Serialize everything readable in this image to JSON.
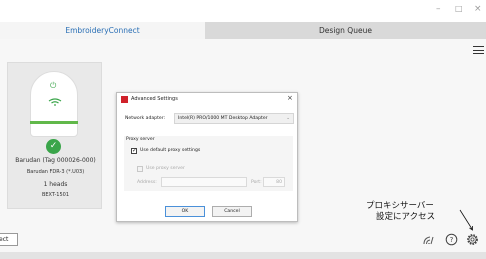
{
  "window": {
    "minimize_glyph": "–",
    "maximize_glyph": "□",
    "close_glyph": "×"
  },
  "tabs": [
    {
      "label": "EmbroideryConnect"
    },
    {
      "label": "Design Queue"
    }
  ],
  "device_card": {
    "name": "Barudan (Tag 000026-000)",
    "model": "Barudan FDR-3 (*.U03)",
    "heads": "1 heads",
    "code": "BEXT-1501",
    "status_color": "#3aa54a"
  },
  "dialog": {
    "title": "Advanced Settings",
    "network_adapter_label": "Network adapter:",
    "network_adapter_value": "Intel(R) PRO/1000 MT Desktop Adapter",
    "proxy_server_label": "Proxy server",
    "use_default_proxy_label": "Use default proxy settings",
    "use_default_proxy_checked": true,
    "use_proxy_server_label": "Use proxy server",
    "use_proxy_server_checked": false,
    "address_label": "Address:",
    "address_value": "",
    "port_label": "Port:",
    "port_value": "80",
    "ok_label": "OK",
    "cancel_label": "Cancel"
  },
  "annotation": {
    "line1": "プロキシサーバー",
    "line2": "設定にアクセス"
  },
  "bottom_bar": {
    "connect_label": "ect",
    "icons": [
      "signal-icon",
      "help-icon",
      "gear-icon"
    ]
  },
  "colors": {
    "tab_active_text": "#2a6fb5",
    "accent_green": "#3aa54a",
    "dialog_icon_red": "#d0212a"
  }
}
